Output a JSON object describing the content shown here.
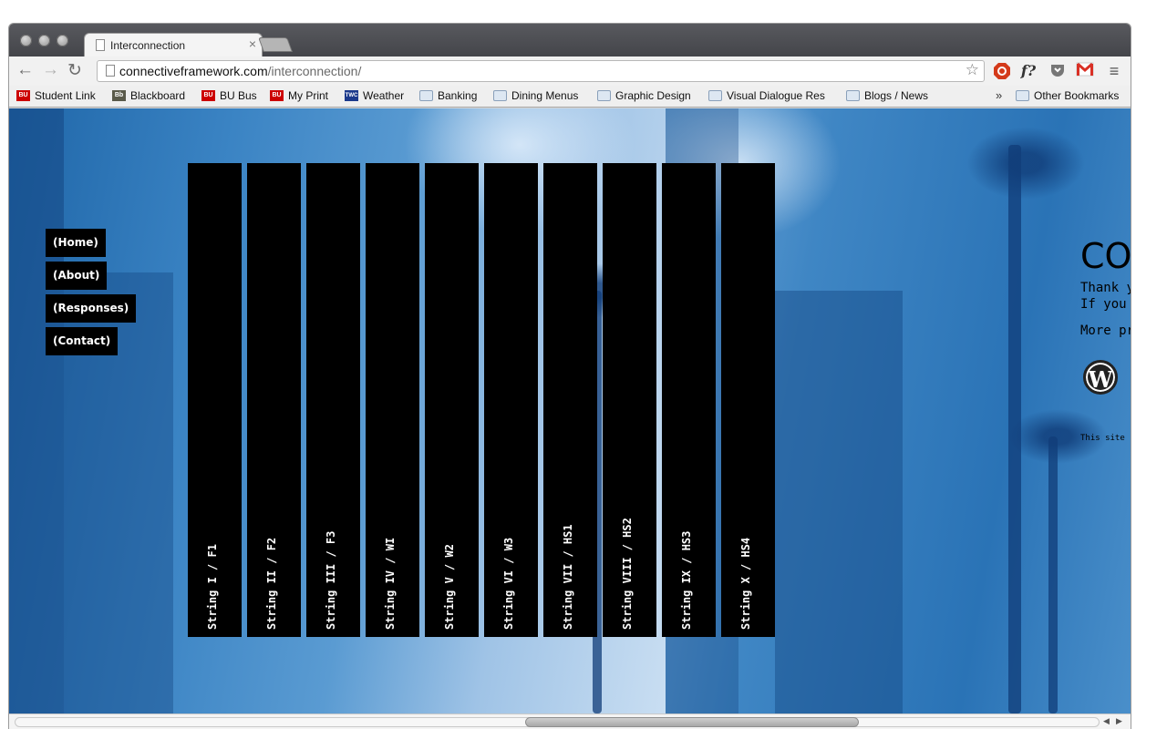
{
  "tab": {
    "title": "Interconnection",
    "close": "×"
  },
  "toolbar": {
    "back": "←",
    "forward": "→",
    "reload": "↻",
    "url_host": "connectiveframework.com",
    "url_path": "/interconnection/",
    "star": "☆",
    "ext_f": "f?",
    "menu": "≡"
  },
  "bookmarks": {
    "items": [
      {
        "label": "Student Link",
        "icon": "BU"
      },
      {
        "label": "Blackboard",
        "icon": "Bb"
      },
      {
        "label": "BU Bus",
        "icon": "BU"
      },
      {
        "label": "My Print",
        "icon": "BU"
      },
      {
        "label": "Weather",
        "icon": "TWC"
      },
      {
        "label": "Banking",
        "icon": "folder-icon"
      },
      {
        "label": "Dining Menus",
        "icon": "folder-icon"
      },
      {
        "label": "Graphic Design",
        "icon": "folder-icon"
      },
      {
        "label": "Visual Dialogue Res",
        "icon": "folder-icon"
      },
      {
        "label": "Blogs / News",
        "icon": "folder-icon"
      }
    ],
    "more": "»",
    "other": "Other Bookmarks"
  },
  "nav": {
    "home": "(Home)",
    "about": "(About)",
    "responses": "(Responses)",
    "contact": "(Contact)"
  },
  "strings": [
    "String I / F1",
    "String II / F2",
    "String III / F3",
    "String IV / WI",
    "String V / W2",
    "String VI / W3",
    "String VII / HS1",
    "String VIII / HS2",
    "String IX / HS3",
    "String X / HS4"
  ],
  "side_panel": {
    "heading": "CO",
    "line1": "Thank y",
    "line2": "If you",
    "line3": "More pr",
    "wp_logo": "W",
    "small": "This site"
  },
  "colors": {
    "background_blue": "#2a78bd",
    "string_bar": "#000000",
    "nav_button": "#000000"
  }
}
